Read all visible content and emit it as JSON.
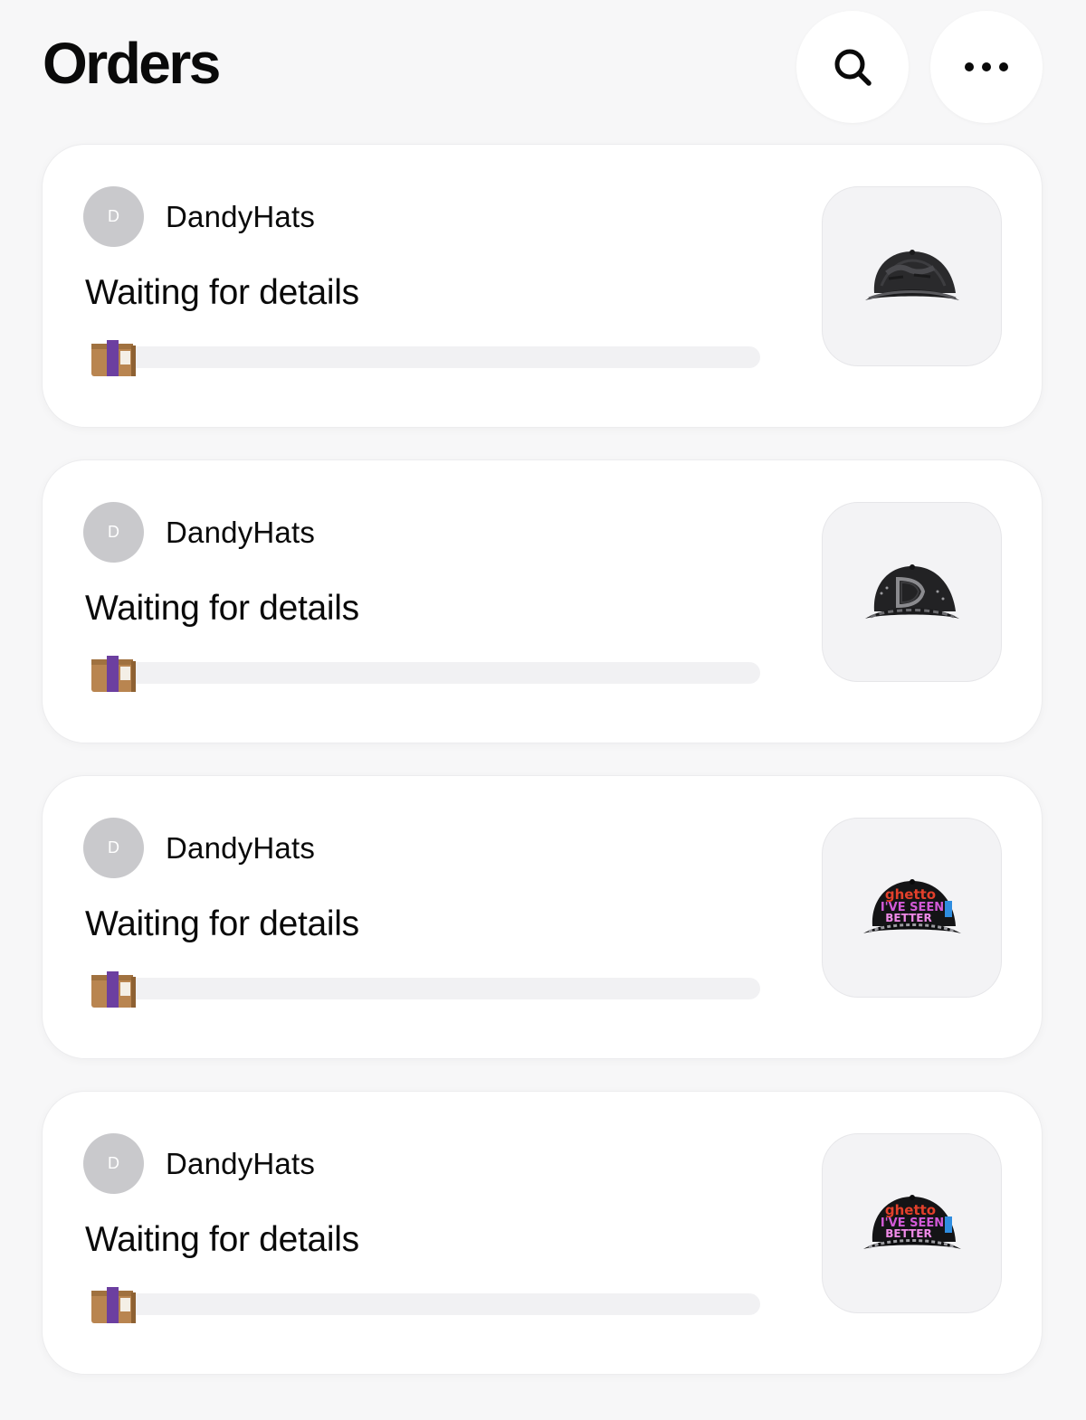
{
  "header": {
    "title": "Orders",
    "search_icon": "search-icon",
    "more_icon": "more-horizontal-icon"
  },
  "orders": [
    {
      "seller_initial": "D",
      "seller_name": "DandyHats",
      "status": "Waiting for details",
      "progress": 0.0,
      "product_image": "black-distressed-cap"
    },
    {
      "seller_initial": "D",
      "seller_name": "DandyHats",
      "status": "Waiting for details",
      "progress": 0.0,
      "product_image": "black-d-logo-cap"
    },
    {
      "seller_initial": "D",
      "seller_name": "DandyHats",
      "status": "Waiting for details",
      "progress": 0.0,
      "product_image": "black-colorful-graphic-cap",
      "product_text": [
        "ghetto",
        "I'VE SEEN",
        "BETTER"
      ]
    },
    {
      "seller_initial": "D",
      "seller_name": "DandyHats",
      "status": "Waiting for details",
      "progress": 0.0,
      "product_image": "black-colorful-graphic-cap",
      "product_text": [
        "ghetto",
        "I'VE SEEN",
        "BETTER"
      ]
    }
  ],
  "colors": {
    "background": "#f7f7f8",
    "card": "#ffffff",
    "avatar": "#c9c9cc",
    "progress_track": "#f1f1f3",
    "package_box": "#b98550",
    "package_tape": "#6c3fa0"
  }
}
